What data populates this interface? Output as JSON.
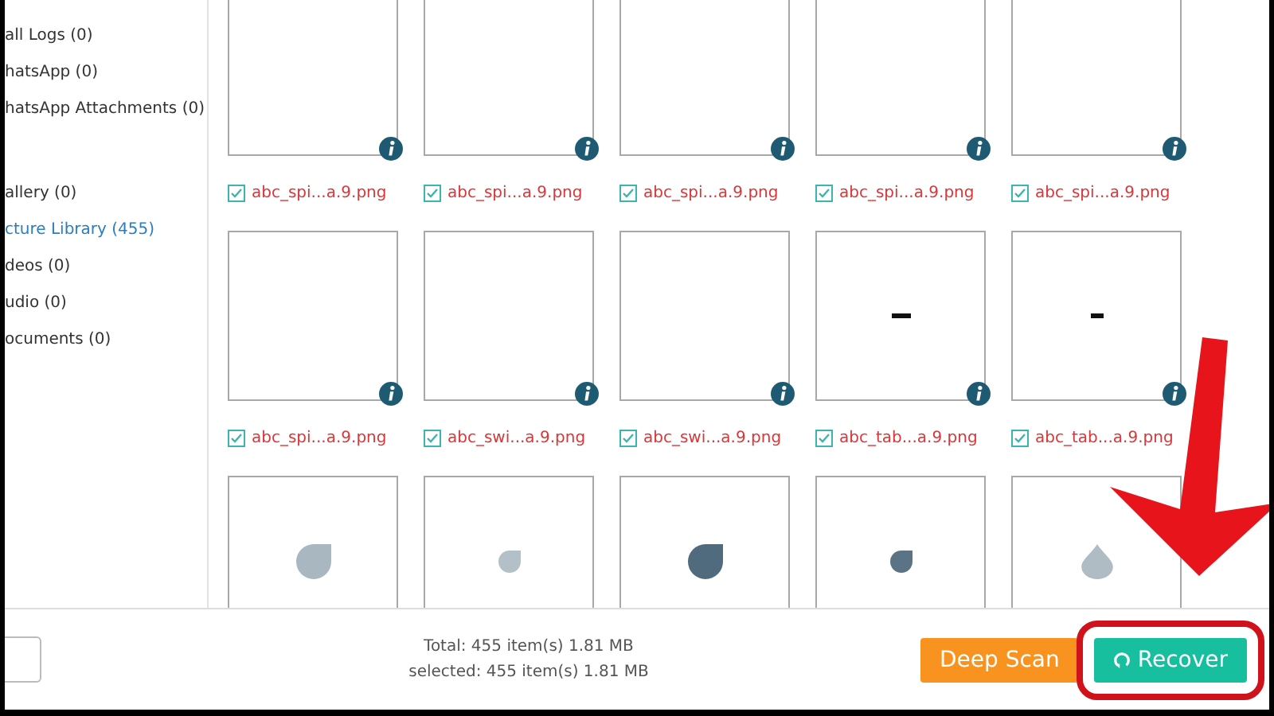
{
  "sidebar": {
    "groups": [
      {
        "items": [
          {
            "label": "all Logs (0)",
            "selected": false
          },
          {
            "label": "hatsApp (0)",
            "selected": false
          },
          {
            "label": "hatsApp Attachments (0)",
            "selected": false
          }
        ]
      },
      {
        "items": [
          {
            "label": "allery (0)",
            "selected": false
          },
          {
            "label": "cture Library (455)",
            "selected": true
          },
          {
            "label": "deos (0)",
            "selected": false
          },
          {
            "label": "udio (0)",
            "selected": false
          },
          {
            "label": "ocuments (0)",
            "selected": false
          }
        ]
      }
    ]
  },
  "files": [
    {
      "name": "abc_spi...a.9.png",
      "checked": true,
      "kind": "blank"
    },
    {
      "name": "abc_spi...a.9.png",
      "checked": true,
      "kind": "blank"
    },
    {
      "name": "abc_spi...a.9.png",
      "checked": true,
      "kind": "blank"
    },
    {
      "name": "abc_spi...a.9.png",
      "checked": true,
      "kind": "blank"
    },
    {
      "name": "abc_spi...a.9.png",
      "checked": true,
      "kind": "blank"
    },
    {
      "name": "abc_spi...a.9.png",
      "checked": true,
      "kind": "blank"
    },
    {
      "name": "abc_swi...a.9.png",
      "checked": true,
      "kind": "blank"
    },
    {
      "name": "abc_swi...a.9.png",
      "checked": true,
      "kind": "blank"
    },
    {
      "name": "abc_tab...a.9.png",
      "checked": true,
      "kind": "dash"
    },
    {
      "name": "abc_tab...a.9.png",
      "checked": true,
      "kind": "dash"
    },
    {
      "kind": "drop",
      "color": "#a9b7c0"
    },
    {
      "kind": "drop",
      "color": "#b3c0c8"
    },
    {
      "kind": "drop",
      "color": "#4f6b7d"
    },
    {
      "kind": "drop",
      "color": "#5a7486"
    },
    {
      "kind": "drop",
      "color": "#b0bcc4"
    }
  ],
  "status": {
    "total": "Total: 455 item(s) 1.81 MB",
    "selected": "selected: 455 item(s) 1.81 MB"
  },
  "buttons": [
    {
      "label": "Deep Scan",
      "kind": "scan"
    },
    {
      "label": "Recover",
      "kind": "recover",
      "highlighted": true
    }
  ]
}
